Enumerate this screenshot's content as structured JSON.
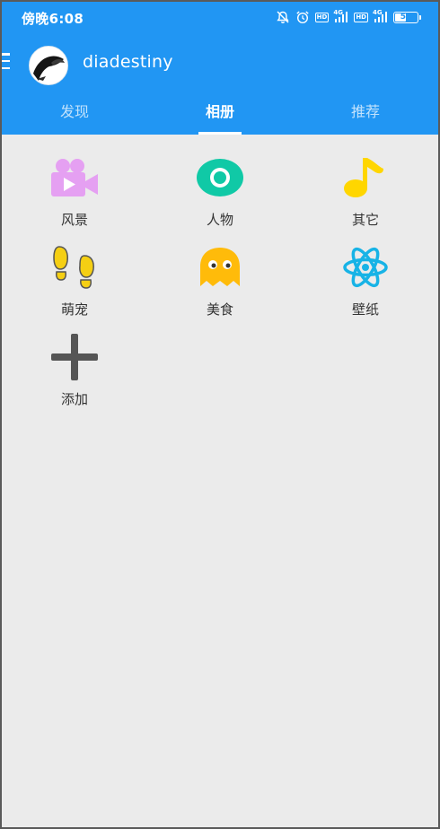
{
  "status_bar": {
    "time": "傍晚6:08",
    "hd_label": "HD",
    "network_label": "4G",
    "battery_level": "54"
  },
  "header": {
    "username": "diadestiny"
  },
  "tabs": [
    {
      "label": "发现",
      "active": false
    },
    {
      "label": "相册",
      "active": true
    },
    {
      "label": "推荐",
      "active": false
    }
  ],
  "albums": [
    {
      "label": "风景",
      "icon": "video-camera-icon",
      "color": "#e5a0f2"
    },
    {
      "label": "人物",
      "icon": "disc-icon",
      "color": "#10c9a6"
    },
    {
      "label": "其它",
      "icon": "music-note-icon",
      "color": "#ffd600"
    },
    {
      "label": "萌宠",
      "icon": "footprints-icon",
      "color": "#f5cf13"
    },
    {
      "label": "美食",
      "icon": "ghost-icon",
      "color": "#ffbb0a"
    },
    {
      "label": "壁纸",
      "icon": "atom-icon",
      "color": "#17b3e6"
    },
    {
      "label": "添加",
      "icon": "plus-icon",
      "color": "#555555"
    }
  ],
  "colors": {
    "primary": "#2196f3",
    "background": "#ebebeb"
  }
}
